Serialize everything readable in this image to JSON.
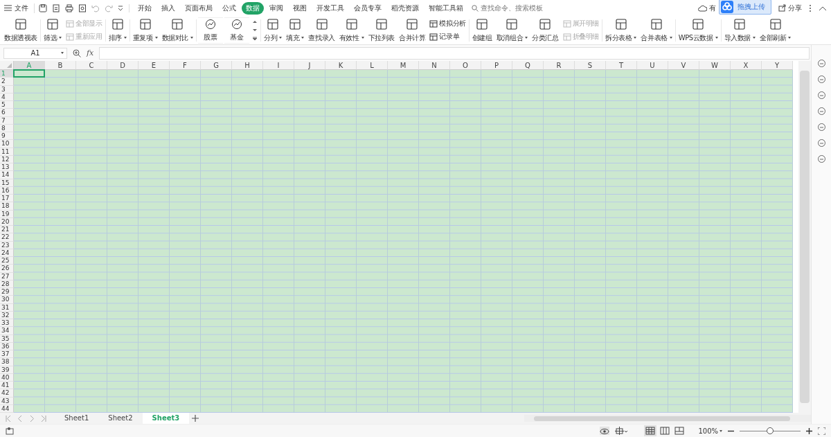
{
  "title_bar": {
    "file_menu": "文件",
    "tabs": [
      {
        "label": "开始",
        "selected": false
      },
      {
        "label": "插入",
        "selected": false
      },
      {
        "label": "页面布局",
        "selected": false
      },
      {
        "label": "公式",
        "selected": false
      },
      {
        "label": "数据",
        "selected": true
      },
      {
        "label": "审阅",
        "selected": false
      },
      {
        "label": "视图",
        "selected": false
      },
      {
        "label": "开发工具",
        "selected": false
      },
      {
        "label": "会员专享",
        "selected": false
      },
      {
        "label": "稻壳资源",
        "selected": false
      },
      {
        "label": "智能工具箱",
        "selected": false
      }
    ],
    "search": {
      "placeholder": "查找命令、搜索模板"
    },
    "cloud_label": "有",
    "upload_popup": "拖拽上传",
    "share": "分享"
  },
  "ribbon": [
    {
      "items": [
        {
          "kind": "large",
          "label": "数据透视表",
          "dropdown": false
        }
      ]
    },
    {
      "items": [
        {
          "kind": "large",
          "label": "筛选",
          "dropdown": true
        },
        {
          "kind": "small",
          "label": "全部显示",
          "disabled": true
        },
        {
          "kind": "small",
          "label": "重新应用",
          "disabled": true
        }
      ]
    },
    {
      "items": [
        {
          "kind": "large",
          "label": "排序",
          "dropdown": true
        }
      ]
    },
    {
      "items": [
        {
          "kind": "large",
          "label": "重复项",
          "dropdown": true
        },
        {
          "kind": "large",
          "label": "数据对比",
          "dropdown": true
        }
      ]
    },
    {
      "items": [
        {
          "kind": "gallery",
          "label": "股票"
        },
        {
          "kind": "gallery",
          "label": "基金"
        }
      ]
    },
    {
      "items": [
        {
          "kind": "large",
          "label": "分列",
          "dropdown": true
        },
        {
          "kind": "large",
          "label": "填充",
          "dropdown": true
        },
        {
          "kind": "large",
          "label": "查找录入",
          "dropdown": false
        },
        {
          "kind": "large",
          "label": "有效性",
          "dropdown": true
        },
        {
          "kind": "large",
          "label": "下拉列表",
          "dropdown": false
        },
        {
          "kind": "large",
          "label": "合并计算",
          "dropdown": false
        },
        {
          "kind": "small",
          "label": "模拟分析",
          "disabled": false
        },
        {
          "kind": "small",
          "label": "记录单",
          "disabled": false
        }
      ]
    },
    {
      "items": [
        {
          "kind": "large",
          "label": "创建组",
          "dropdown": false
        },
        {
          "kind": "large",
          "label": "取消组合",
          "dropdown": true
        },
        {
          "kind": "large",
          "label": "分类汇总",
          "dropdown": false
        },
        {
          "kind": "small",
          "label": "展开明细",
          "disabled": true
        },
        {
          "kind": "small",
          "label": "折叠明细",
          "disabled": true
        }
      ]
    },
    {
      "items": [
        {
          "kind": "large",
          "label": "拆分表格",
          "dropdown": true
        },
        {
          "kind": "large",
          "label": "合并表格",
          "dropdown": true
        }
      ]
    },
    {
      "items": [
        {
          "kind": "large",
          "label": "WPS云数据",
          "dropdown": true
        }
      ]
    },
    {
      "items": [
        {
          "kind": "large",
          "label": "导入数据",
          "dropdown": true
        },
        {
          "kind": "large",
          "label": "全部刷新",
          "dropdown": true
        }
      ]
    }
  ],
  "formula_bar": {
    "name_box": "A1",
    "fx": "fx"
  },
  "sheet": {
    "columns": [
      {
        "label": "A",
        "selected": true
      },
      {
        "label": "B",
        "selected": false
      },
      {
        "label": "C",
        "selected": false
      },
      {
        "label": "D",
        "selected": false
      },
      {
        "label": "E",
        "selected": false
      },
      {
        "label": "F",
        "selected": false
      },
      {
        "label": "G",
        "selected": false
      },
      {
        "label": "H",
        "selected": false
      },
      {
        "label": "I",
        "selected": false
      },
      {
        "label": "J",
        "selected": false
      },
      {
        "label": "K",
        "selected": false
      },
      {
        "label": "L",
        "selected": false
      },
      {
        "label": "M",
        "selected": false
      },
      {
        "label": "N",
        "selected": false
      },
      {
        "label": "O",
        "selected": false
      },
      {
        "label": "P",
        "selected": false
      },
      {
        "label": "Q",
        "selected": false
      },
      {
        "label": "R",
        "selected": false
      },
      {
        "label": "S",
        "selected": false
      },
      {
        "label": "T",
        "selected": false
      },
      {
        "label": "U",
        "selected": false
      },
      {
        "label": "V",
        "selected": false
      },
      {
        "label": "W",
        "selected": false
      },
      {
        "label": "X",
        "selected": false
      },
      {
        "label": "Y",
        "selected": false
      }
    ],
    "rows": [
      {
        "label": "1",
        "selected": true
      },
      {
        "label": "2",
        "selected": false
      },
      {
        "label": "3",
        "selected": false
      },
      {
        "label": "4",
        "selected": false
      },
      {
        "label": "5",
        "selected": false
      },
      {
        "label": "6",
        "selected": false
      },
      {
        "label": "7",
        "selected": false
      },
      {
        "label": "8",
        "selected": false
      },
      {
        "label": "9",
        "selected": false
      },
      {
        "label": "10",
        "selected": false
      },
      {
        "label": "11",
        "selected": false
      },
      {
        "label": "12",
        "selected": false
      },
      {
        "label": "13",
        "selected": false
      },
      {
        "label": "14",
        "selected": false
      },
      {
        "label": "15",
        "selected": false
      },
      {
        "label": "16",
        "selected": false
      },
      {
        "label": "17",
        "selected": false
      },
      {
        "label": "18",
        "selected": false
      },
      {
        "label": "19",
        "selected": false
      },
      {
        "label": "20",
        "selected": false
      },
      {
        "label": "21",
        "selected": false
      },
      {
        "label": "22",
        "selected": false
      },
      {
        "label": "23",
        "selected": false
      },
      {
        "label": "24",
        "selected": false
      },
      {
        "label": "25",
        "selected": false
      },
      {
        "label": "26",
        "selected": false
      },
      {
        "label": "27",
        "selected": false
      },
      {
        "label": "28",
        "selected": false
      },
      {
        "label": "29",
        "selected": false
      },
      {
        "label": "30",
        "selected": false
      },
      {
        "label": "31",
        "selected": false
      },
      {
        "label": "32",
        "selected": false
      },
      {
        "label": "33",
        "selected": false
      },
      {
        "label": "34",
        "selected": false
      },
      {
        "label": "35",
        "selected": false
      },
      {
        "label": "36",
        "selected": false
      },
      {
        "label": "37",
        "selected": false
      },
      {
        "label": "38",
        "selected": false
      },
      {
        "label": "39",
        "selected": false
      },
      {
        "label": "40",
        "selected": false
      },
      {
        "label": "41",
        "selected": false
      },
      {
        "label": "42",
        "selected": false
      },
      {
        "label": "43",
        "selected": false
      },
      {
        "label": "44",
        "selected": false
      }
    ]
  },
  "sheet_tabs": [
    {
      "label": "Sheet1",
      "selected": false
    },
    {
      "label": "Sheet2",
      "selected": false
    },
    {
      "label": "Sheet3",
      "selected": true
    }
  ],
  "status_bar": {
    "views": [
      {
        "selected": true
      },
      {
        "selected": false
      },
      {
        "selected": false
      }
    ],
    "zoom": "100%",
    "zoom_slider": {
      "level": 0.5
    }
  }
}
